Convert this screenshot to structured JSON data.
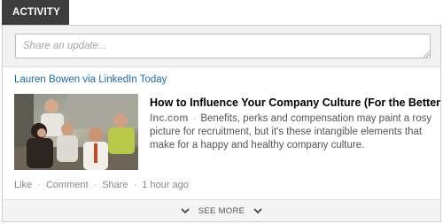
{
  "tab": {
    "label": "ACTIVITY"
  },
  "share": {
    "placeholder": "Share an update..."
  },
  "post": {
    "attribution": "Lauren Bowen via LinkedIn Today",
    "headline": "How to Influence Your Company Culture (For the Better)",
    "source": "Inc.com",
    "summary": "Benefits, perks and compensation may paint a rosy picture for recruitment, but it's these intangible elements that make for a happy and healthy company culture.",
    "thumbnail_icon": "group-photo-thumbnail"
  },
  "actions": {
    "like": "Like",
    "comment": "Comment",
    "share": "Share",
    "time": "1 hour ago"
  },
  "footer": {
    "see_more": "SEE MORE"
  },
  "colors": {
    "tab_bg": "#3d3d3d",
    "link_blue": "#1e6aa8",
    "panel_bg": "#f2f2f2"
  }
}
